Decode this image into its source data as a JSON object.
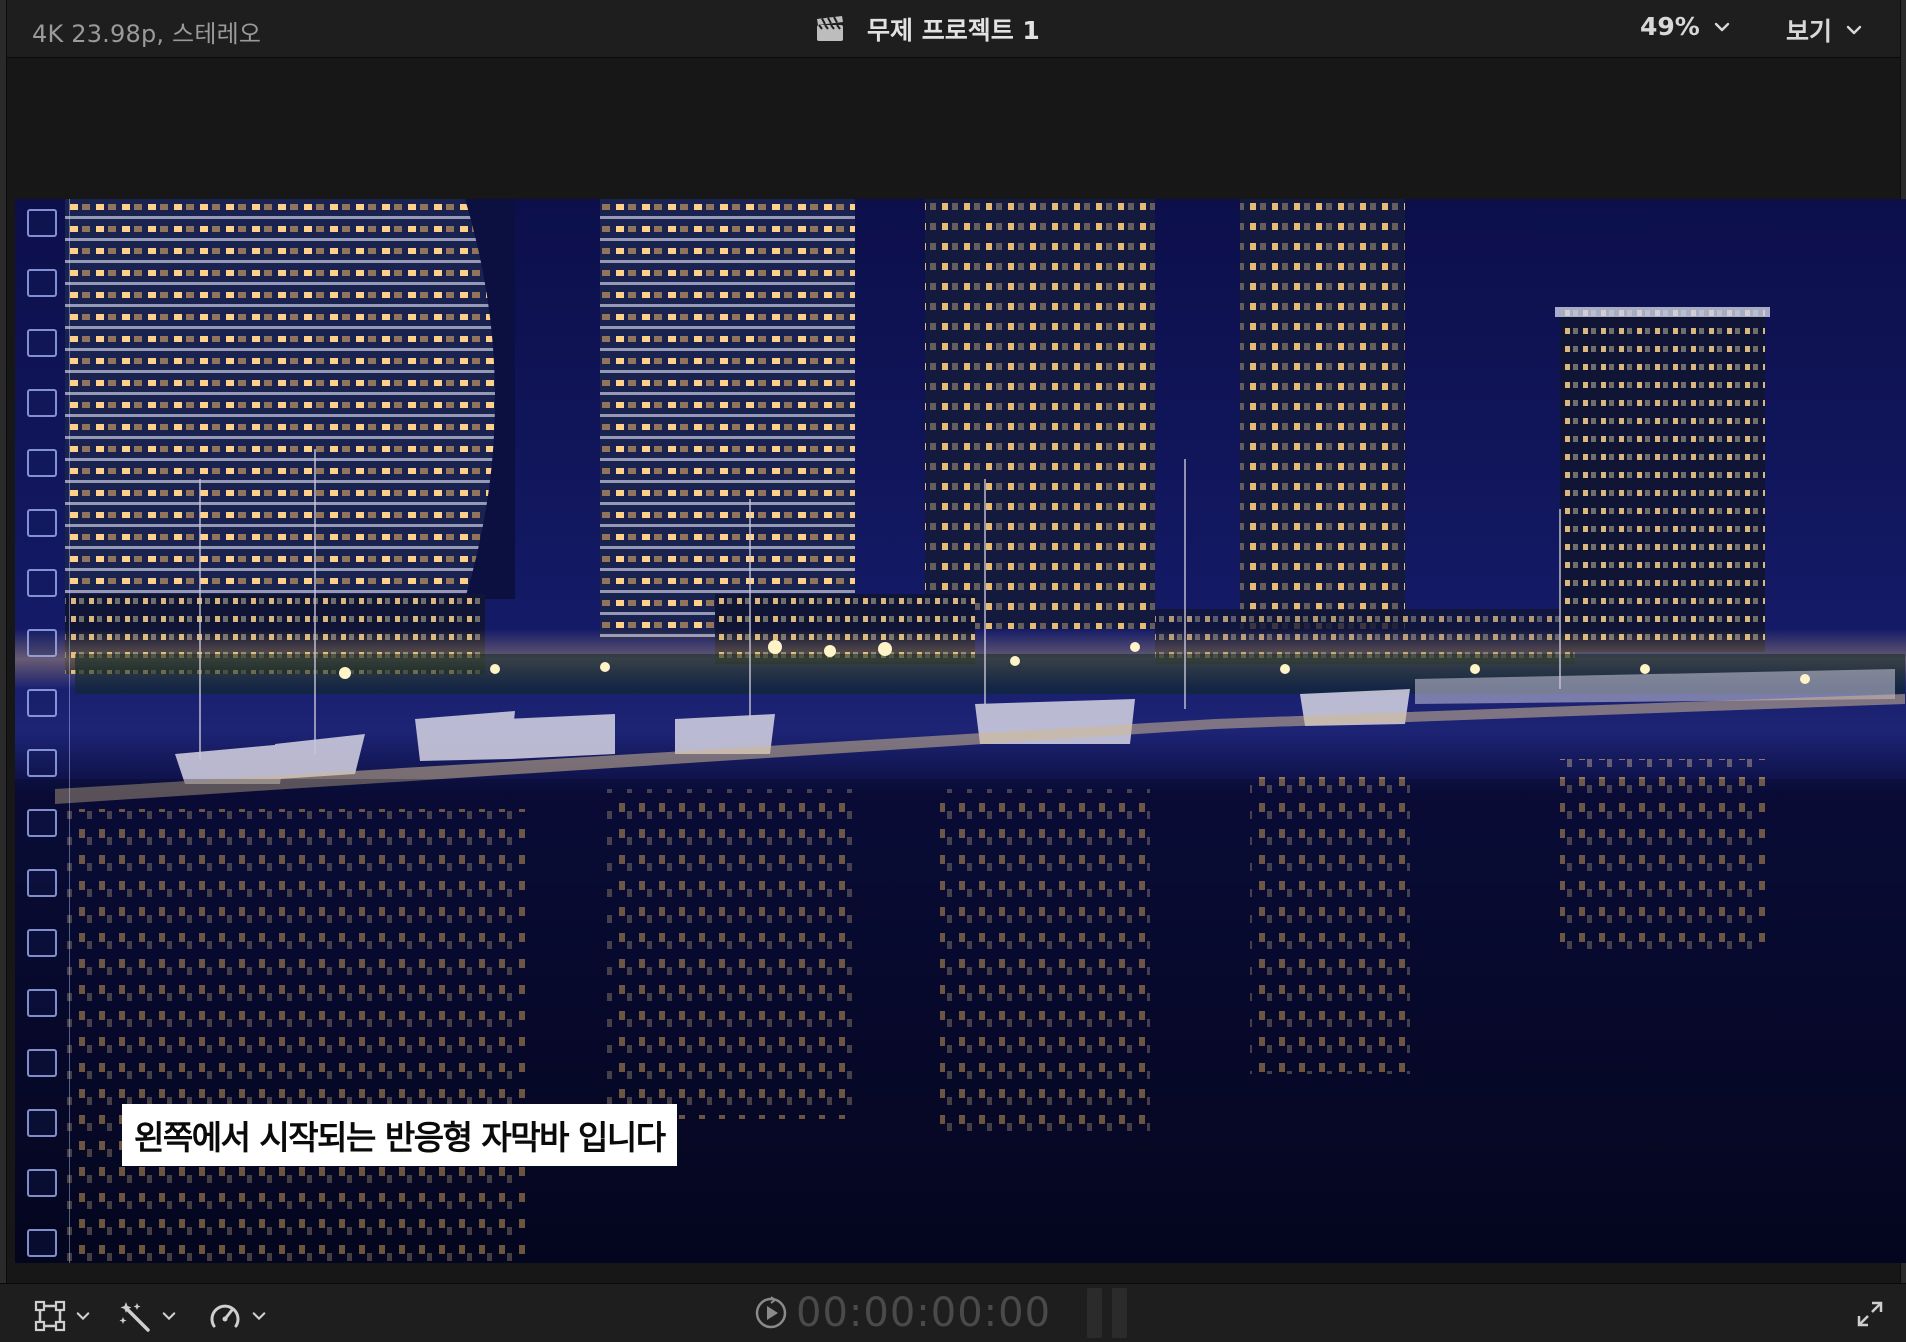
{
  "topbar": {
    "format_label": "4K 23.98p, 스테레오",
    "project_title": "무제 프로젝트 1",
    "zoom_value": "49%",
    "view_label": "보기"
  },
  "viewer": {
    "subtitle_text": "왼쪽에서 시작되는 반응형 자막바 입니다"
  },
  "bottombar": {
    "timecode": "00:00:00:00"
  },
  "icons": {
    "clapper": "clapperboard-icon",
    "transform": "transform-crop-icon",
    "enhance": "magic-wand-icon",
    "retime": "retime-speedometer-icon",
    "play": "play-icon",
    "fullscreen": "fullscreen-icon"
  },
  "colors": {
    "accent_text": "#e2e2e2",
    "muted_text": "#9a9a9a",
    "timecode_dim": "#4a4a4a",
    "subtitle_bg": "#ffffff"
  }
}
